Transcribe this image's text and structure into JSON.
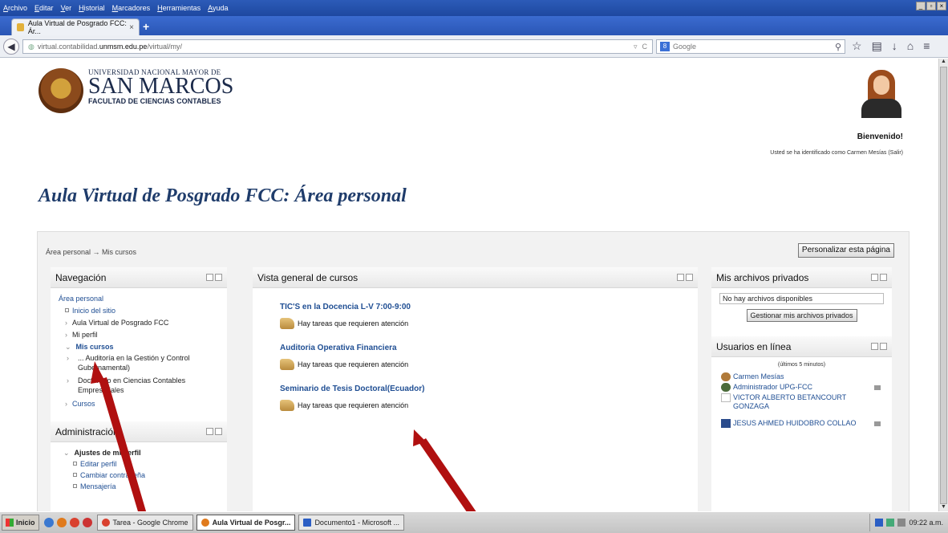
{
  "browser": {
    "menu": [
      "Archivo",
      "Editar",
      "Ver",
      "Historial",
      "Marcadores",
      "Herramientas",
      "Ayuda"
    ],
    "tab_title": "Aula Virtual de Posgrado FCC: Ár...",
    "url_prefix": "virtual.contabilidad.",
    "url_domain": "unmsm.edu.pe",
    "url_path": "/virtual/my/",
    "search_placeholder": "Google",
    "search_engine_badge": "8"
  },
  "header": {
    "logo_line1": "UNIVERSIDAD NACIONAL MAYOR DE",
    "logo_line2": "SAN MARCOS",
    "logo_line3": "FACULTAD DE CIENCIAS CONTABLES",
    "welcome": "Bienvenido!",
    "logged_in": "Usted se ha identificado como Carmen Mesías (Salir)"
  },
  "page": {
    "title": "Aula Virtual de Posgrado FCC: Área personal",
    "breadcrumb": "Área personal → Mis cursos",
    "customize_button": "Personalizar esta página"
  },
  "navigation": {
    "title": "Navegación",
    "home": "Área personal",
    "site_home": "Inicio del sitio",
    "aula": "Aula Virtual de Posgrado FCC",
    "profile": "Mi perfil",
    "my_courses": "Mis cursos",
    "course1": "... Auditoría en la Gestión y Control Gubernamental)",
    "course2": "Doctorado en Ciencias Contables Empresariales",
    "courses": "Cursos"
  },
  "administration": {
    "title": "Administración",
    "profile_settings": "Ajustes de mi perfil",
    "edit_profile": "Editar perfil",
    "change_password": "Cambiar contraseña",
    "messaging": "Mensajería"
  },
  "courses_overview": {
    "title": "Vista general de cursos",
    "items": [
      {
        "name": "TIC'S en la Docencia L-V 7:00-9:00",
        "note": "Hay tareas que requieren atención"
      },
      {
        "name": "Auditoria Operativa Financiera",
        "note": "Hay tareas que requieren atención"
      },
      {
        "name": "Seminario de Tesis Doctoral(Ecuador)",
        "note": "Hay tareas que requieren atención"
      }
    ]
  },
  "private_files": {
    "title": "Mis archivos privados",
    "empty": "No hay archivos disponibles",
    "manage_button": "Gestionar mis archivos privados"
  },
  "online_users": {
    "title": "Usuarios en línea",
    "subtitle": "(últimos 5 minutos)",
    "users": [
      "Carmen Mesías",
      "Administrador UPG-FCC",
      "VICTOR ALBERTO BETANCOURT GONZAGA",
      "JESUS AHMED HUIDOBRO COLLAO"
    ]
  },
  "taskbar": {
    "start": "Inicio",
    "tasks": [
      "Tarea - Google Chrome",
      "Aula Virtual de Posgr...",
      "Documento1 - Microsoft ..."
    ],
    "clock": "09:22 a.m."
  },
  "colors": {
    "title_blue": "#1f3c6b",
    "link_blue": "#1f4e93",
    "arrow_red": "#b01010"
  }
}
